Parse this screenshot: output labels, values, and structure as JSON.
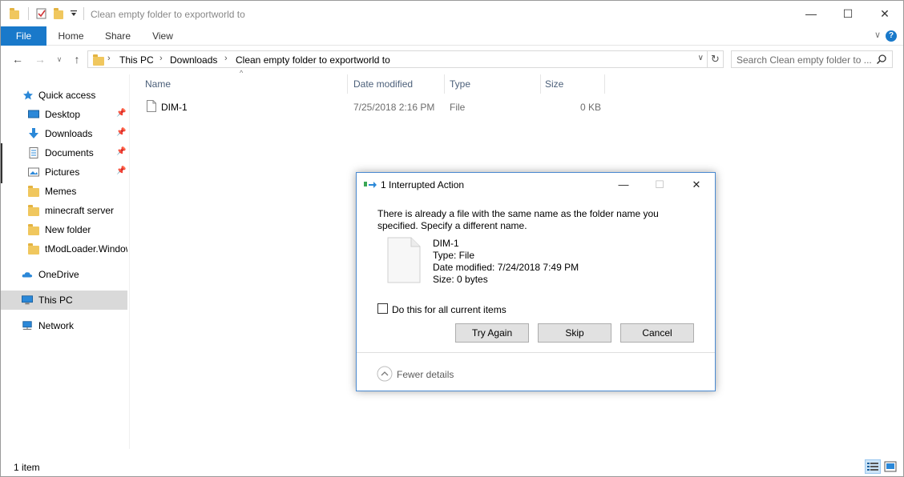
{
  "window": {
    "title": "Clean empty folder to exportworld to",
    "minimize": "—",
    "maximize": "☐",
    "close": "✕"
  },
  "ribbon": {
    "tabs": [
      "File",
      "Home",
      "Share",
      "View"
    ],
    "expand": "∨",
    "help": "?"
  },
  "nav": {
    "back": "←",
    "forward": "→",
    "recent": "∨",
    "up": "↑"
  },
  "address": {
    "crumbs": [
      "This PC",
      "Downloads",
      "Clean empty folder to exportworld to"
    ],
    "separator": "›",
    "dropdown": "∨",
    "refresh": "↻"
  },
  "search": {
    "placeholder": "Search Clean empty folder to ..."
  },
  "navpane": {
    "items": [
      {
        "label": "Quick access"
      },
      {
        "label": "Desktop",
        "pinned": true
      },
      {
        "label": "Downloads",
        "pinned": true
      },
      {
        "label": "Documents",
        "pinned": true
      },
      {
        "label": "Pictures",
        "pinned": true
      },
      {
        "label": "Memes"
      },
      {
        "label": "minecraft server"
      },
      {
        "label": "New folder"
      },
      {
        "label": "tModLoader.Windows"
      },
      {
        "label": "OneDrive"
      },
      {
        "label": "This PC",
        "selected": true
      },
      {
        "label": "Network"
      }
    ],
    "pin_glyph": "📌"
  },
  "columns": {
    "name": "Name",
    "date": "Date modified",
    "type": "Type",
    "size": "Size",
    "sort_caret": "^"
  },
  "files": [
    {
      "name": "DIM-1",
      "date": "7/25/2018 2:16 PM",
      "type": "File",
      "size": "0 KB"
    }
  ],
  "status": {
    "count": "1 item"
  },
  "dialog": {
    "title": "1 Interrupted Action",
    "minimize": "—",
    "maximize": "☐",
    "close": "✕",
    "message": "There is already a file with the same name as the folder name you specified. Specify a different name.",
    "file_name": "DIM-1",
    "file_type": "Type: File",
    "file_date": "Date modified: 7/24/2018 7:49 PM",
    "file_size": "Size: 0 bytes",
    "checkbox_label": "Do this for all current items",
    "buttons": {
      "try_again": "Try Again",
      "skip": "Skip",
      "cancel": "Cancel"
    },
    "fewer_details": "Fewer details"
  },
  "colors": {
    "accent": "#1979ca",
    "folder": "#f0c75e",
    "selection": "#d9d9d9",
    "dialog_border": "#4a8ad1"
  }
}
